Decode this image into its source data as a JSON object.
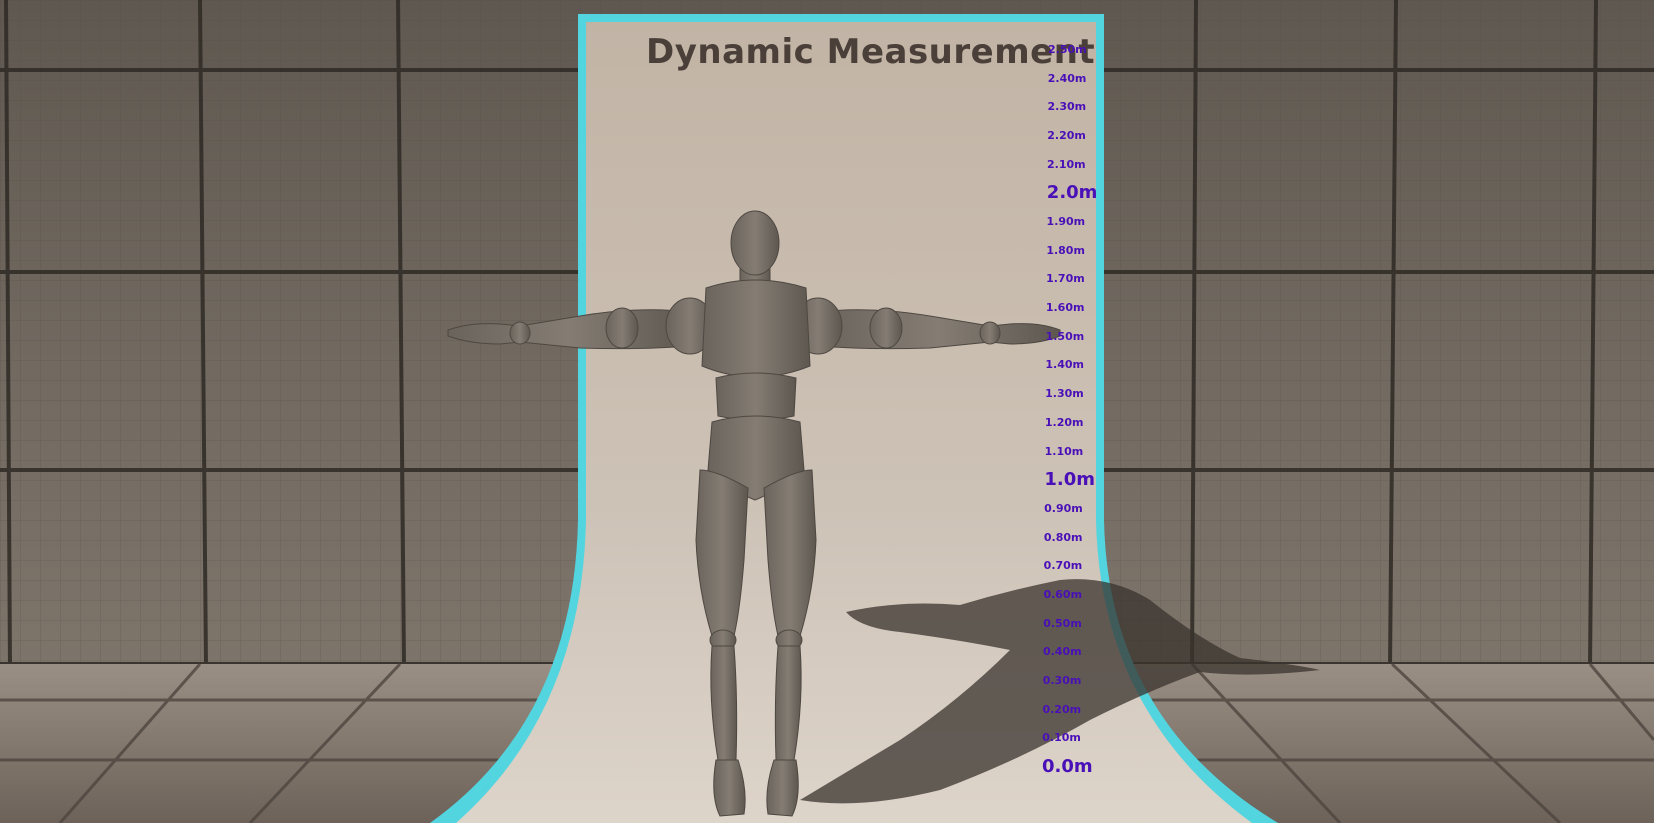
{
  "title": "Dynamic Measurement",
  "ruler": {
    "unit_color": "#4a10b8",
    "marks": [
      {
        "label": "2.50m",
        "value": 2.5
      },
      {
        "label": "2.40m",
        "value": 2.4
      },
      {
        "label": "2.30m",
        "value": 2.3
      },
      {
        "label": "2.20m",
        "value": 2.2
      },
      {
        "label": "2.10m",
        "value": 2.1
      },
      {
        "label": "2.0m",
        "value": 2.0,
        "major": true
      },
      {
        "label": "1.90m",
        "value": 1.9
      },
      {
        "label": "1.80m",
        "value": 1.8
      },
      {
        "label": "1.70m",
        "value": 1.7
      },
      {
        "label": "1.60m",
        "value": 1.6
      },
      {
        "label": "1.50m",
        "value": 1.5
      },
      {
        "label": "1.40m",
        "value": 1.4
      },
      {
        "label": "1.30m",
        "value": 1.3
      },
      {
        "label": "1.20m",
        "value": 1.2
      },
      {
        "label": "1.10m",
        "value": 1.1
      },
      {
        "label": "1.0m",
        "value": 1.0,
        "major": true
      },
      {
        "label": "0.90m",
        "value": 0.9
      },
      {
        "label": "0.80m",
        "value": 0.8
      },
      {
        "label": "0.70m",
        "value": 0.7
      },
      {
        "label": "0.60m",
        "value": 0.6
      },
      {
        "label": "0.50m",
        "value": 0.5
      },
      {
        "label": "0.40m",
        "value": 0.4
      },
      {
        "label": "0.30m",
        "value": 0.3
      },
      {
        "label": "0.20m",
        "value": 0.2
      },
      {
        "label": "0.10m",
        "value": 0.1
      },
      {
        "label": "0.0m",
        "value": 0.0,
        "major": true
      }
    ]
  },
  "colors": {
    "board_outline": "#4fd3dc",
    "board_fill": "#c9bcae",
    "wall": "#6e665e",
    "mannequin": "#7b746c"
  }
}
